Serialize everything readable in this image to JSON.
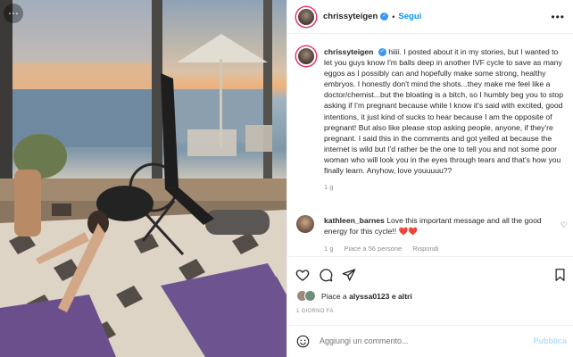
{
  "post": {
    "username": "chrissyteigen",
    "follow_label": "Segui",
    "separator": "•",
    "more_label": "•••",
    "caption_user": "chrissyteigen",
    "caption_text": "hiiii. I posted about it in my stories, but I wanted to let you guys know I'm balls deep in another IVF cycle to save as many eggos as I possibly can and hopefully make some strong, healthy embryos. I honestly don't mind the shots...they make me feel like a doctor/chemist...but the bloating is a bitch, so I humbly beg you to stop asking if I'm pregnant because while I know it's said with excited, good intentions, it just kind of sucks to hear because I am the opposite of pregnant! But also like please stop asking people, anyone, if they're pregnant. I said this in the comments and got yelled at because the internet is wild but I'd rather be the one to tell you and not some poor woman who will look you in the eyes through tears and that's how you finally learn. Anyhow, love youuuuu??",
    "caption_age": "1 g"
  },
  "comment": {
    "username": "kathleen_barnes",
    "text": "Love this important message and all the good energy for this cycle!! ❤️❤️",
    "age": "1 g",
    "likes": "Piace a 56 persone",
    "reply": "Rispondi"
  },
  "likes": {
    "prefix": "Piace a",
    "user": "alyssa0123",
    "suffix": "e altri"
  },
  "date_label": "1 GIORNO FA",
  "add_comment": {
    "placeholder": "Aggiungi un commento...",
    "publish": "Pubblica"
  },
  "colors": {
    "link_blue": "#0095f6",
    "publish_disabled": "#b2dffc",
    "muted": "#8e8e8e",
    "story_ring": "#e1306c"
  },
  "icons": [
    "more-icon",
    "verified-icon",
    "heart-icon",
    "comment-icon",
    "share-icon",
    "bookmark-icon",
    "emoji-icon"
  ]
}
